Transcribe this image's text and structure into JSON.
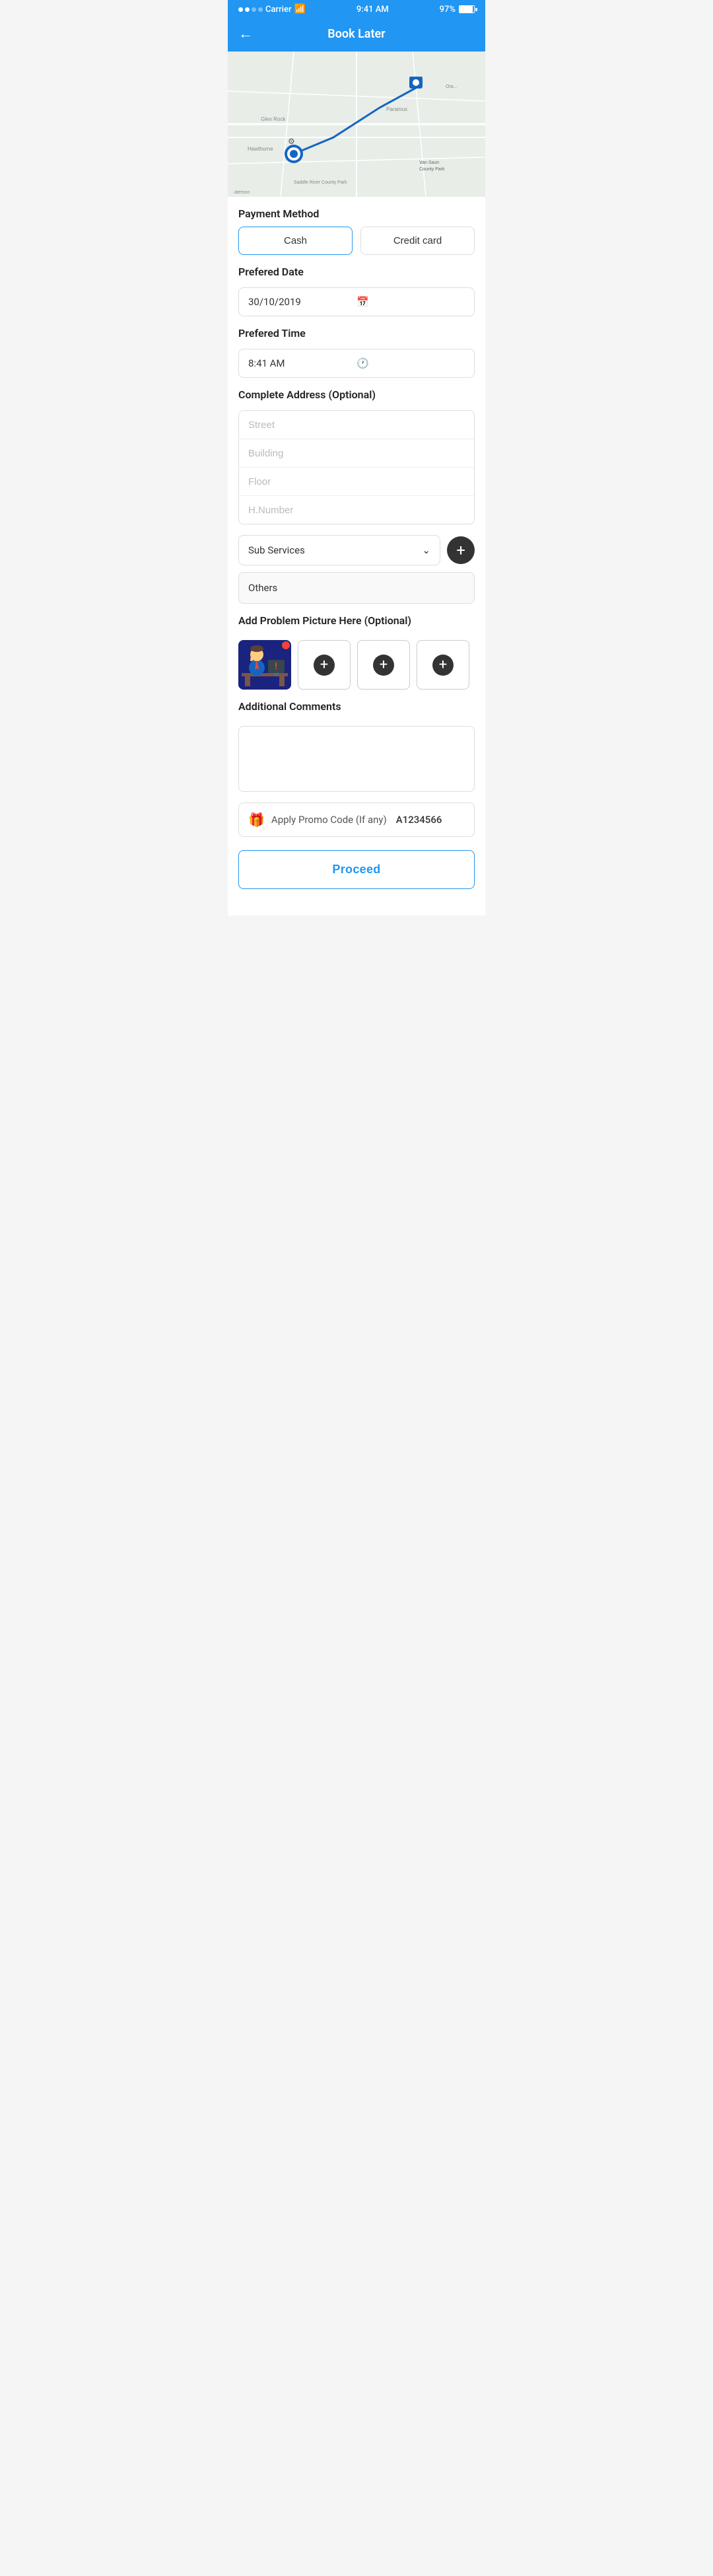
{
  "statusBar": {
    "carrier": "Carrier",
    "time": "9:41 AM",
    "battery": "97%"
  },
  "header": {
    "title": "Book Later",
    "backLabel": "←"
  },
  "paymentMethod": {
    "label": "Payment Method",
    "options": [
      "Cash",
      "Credit card"
    ],
    "selected": "Cash"
  },
  "preferredDate": {
    "label": "Prefered Date",
    "value": "30/10/2019",
    "icon": "calendar-icon"
  },
  "preferredTime": {
    "label": "Prefered Time",
    "value": "8:41 AM",
    "icon": "clock-icon"
  },
  "address": {
    "label": "Complete Address (Optional)",
    "fields": [
      {
        "placeholder": "Street",
        "value": ""
      },
      {
        "placeholder": "Building",
        "value": ""
      },
      {
        "placeholder": "Floor",
        "value": ""
      },
      {
        "placeholder": "H.Number",
        "value": ""
      }
    ]
  },
  "subServices": {
    "label": "Sub Services",
    "placeholder": "Sub Services",
    "addButton": "+"
  },
  "others": {
    "label": "Others"
  },
  "problemPicture": {
    "label": "Add Problem Picture Here (Optional)",
    "addSlots": [
      "+",
      "+",
      "+"
    ]
  },
  "additionalComments": {
    "label": "Additional Comments",
    "placeholder": ""
  },
  "promo": {
    "label": "Apply Promo Code (If any)",
    "code": "A1234566",
    "icon": "🎁"
  },
  "proceed": {
    "label": "Proceed"
  }
}
